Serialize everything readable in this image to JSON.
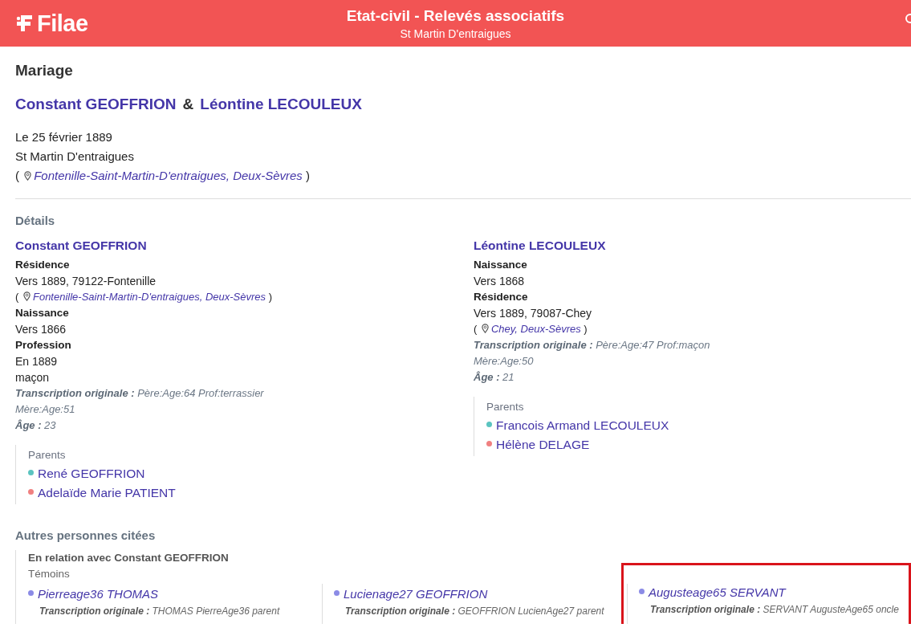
{
  "header": {
    "logo": "Filae",
    "title": "Etat-civil - Relevés associatifs",
    "subtitle": "St Martin D'entraigues"
  },
  "act": {
    "type": "Mariage",
    "spouses": [
      "Constant GEOFFRION",
      "Léontine LECOULEUX"
    ],
    "separator": "&",
    "date": "Le 25 février 1889",
    "place": "St Martin D'entraigues",
    "location": {
      "open": "(",
      "text": "Fontenille-Saint-Martin-D'entraigues, Deux-Sèvres",
      "close": ")"
    }
  },
  "details": {
    "heading": "Détails",
    "persons": [
      {
        "name": "Constant GEOFFRION",
        "facts": [
          {
            "kind": "label",
            "text": "Résidence"
          },
          {
            "kind": "value",
            "text": "Vers 1889, 79122-Fontenille"
          },
          {
            "kind": "location",
            "open": "(",
            "text": "Fontenille-Saint-Martin-D'entraigues, Deux-Sèvres",
            "close": ")"
          },
          {
            "kind": "label",
            "text": "Naissance"
          },
          {
            "kind": "value",
            "text": "Vers 1866"
          },
          {
            "kind": "label",
            "text": "Profession"
          },
          {
            "kind": "value",
            "text": "En 1889"
          },
          {
            "kind": "value",
            "text": "maçon"
          },
          {
            "kind": "note",
            "text": "**Transcription originale :** Père:Age:64 Prof:terrassier Mère:Age:51"
          },
          {
            "kind": "note",
            "text": "**Âge :** 23"
          }
        ],
        "parents": {
          "heading": "Parents",
          "items": [
            {
              "name": "René GEOFFRION",
              "color": "#5bc4c0"
            },
            {
              "name": "Adelaïde Marie PATIENT",
              "color": "#f08080"
            }
          ]
        }
      },
      {
        "name": "Léontine LECOULEUX",
        "facts": [
          {
            "kind": "label",
            "text": "Naissance"
          },
          {
            "kind": "value",
            "text": "Vers 1868"
          },
          {
            "kind": "label",
            "text": "Résidence"
          },
          {
            "kind": "value",
            "text": "Vers 1889, 79087-Chey"
          },
          {
            "kind": "location",
            "open": "(",
            "text": "Chey, Deux-Sèvres",
            "close": ")"
          },
          {
            "kind": "note",
            "text": "**Transcription originale :** Père:Age:47 Prof:maçon Mère:Age:50"
          },
          {
            "kind": "note",
            "text": "**Âge :** 21"
          }
        ],
        "parents": {
          "heading": "Parents",
          "items": [
            {
              "name": "Francois Armand LECOULEUX",
              "color": "#5bc4c0"
            },
            {
              "name": "Hélène DELAGE",
              "color": "#f08080"
            }
          ]
        }
      }
    ]
  },
  "others": {
    "heading": "Autres personnes citées",
    "groups": [
      {
        "relation": "En relation avec Constant GEOFFRION",
        "role": "Témoins",
        "people": [
          {
            "name": "Pierreage36 THOMAS",
            "transcription": "**Transcription originale :** THOMAS PierreAge36 parent",
            "highlighted": false
          },
          {
            "name": "Lucienage27 GEOFFRION",
            "transcription": "**Transcription originale :** GEOFFRION LucienAge27 parent",
            "highlighted": false
          },
          {
            "name": "Augusteage65 SERVANT",
            "transcription": "**Transcription originale :** SERVANT AugusteAge65 oncle",
            "highlighted": true
          }
        ]
      }
    ]
  }
}
